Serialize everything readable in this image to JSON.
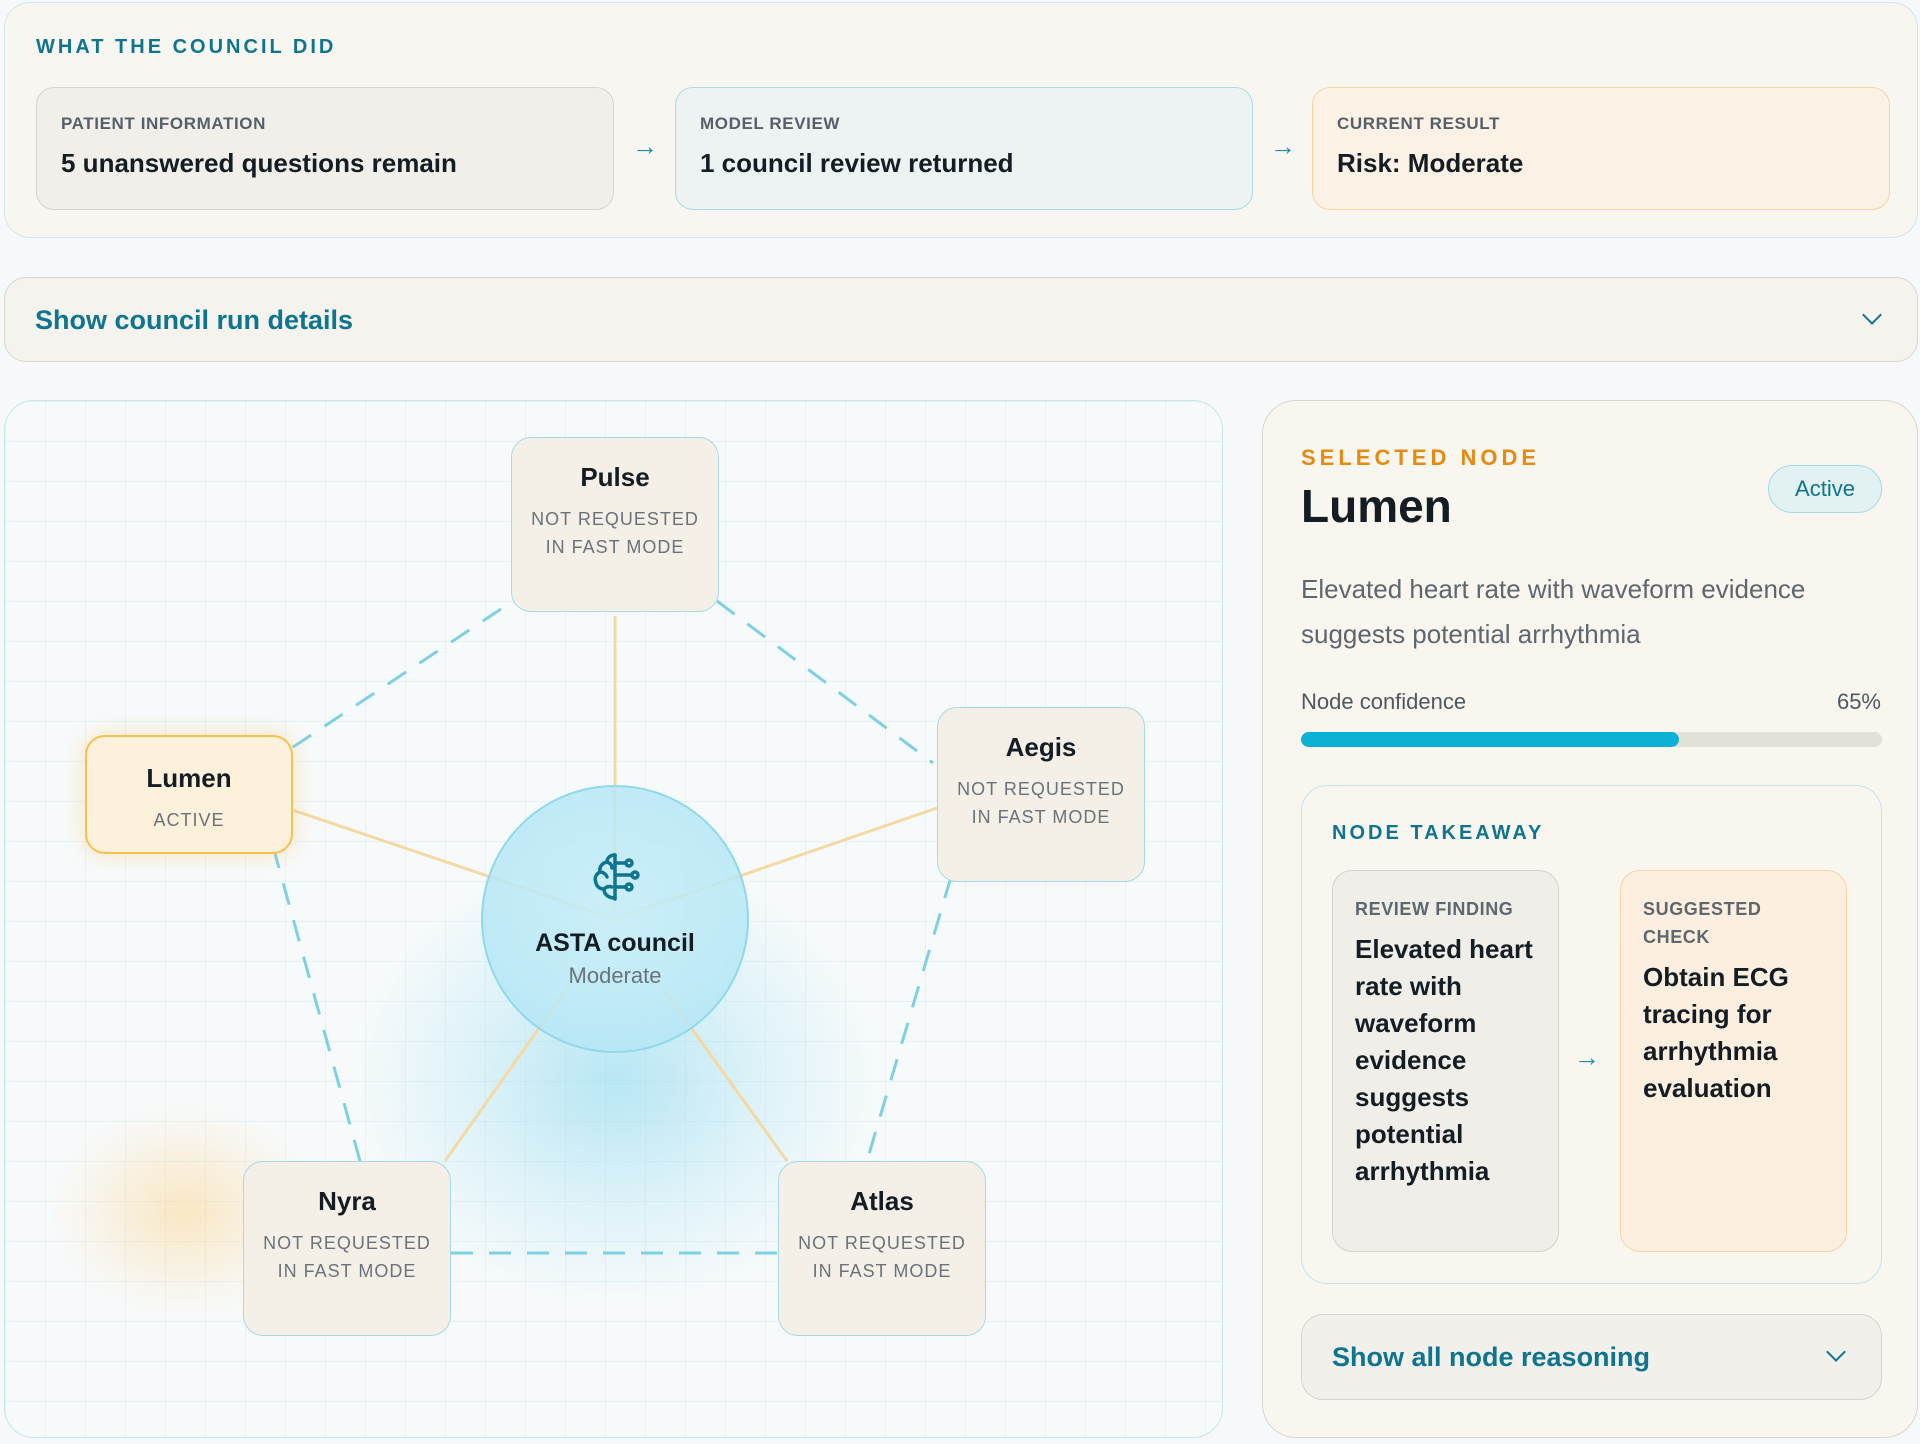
{
  "summary": {
    "heading": "WHAT THE COUNCIL DID",
    "steps": [
      {
        "label": "PATIENT INFORMATION",
        "value": "5 unanswered questions remain"
      },
      {
        "label": "MODEL REVIEW",
        "value": "1 council review returned"
      },
      {
        "label": "CURRENT RESULT",
        "value": "Risk: Moderate"
      }
    ],
    "arrow": "→"
  },
  "details_toggle": {
    "label": "Show council run details"
  },
  "graph": {
    "hub": {
      "title": "ASTA council",
      "status": "Moderate",
      "icon": "brain-icon"
    },
    "nodes": [
      {
        "name": "Pulse",
        "status": "NOT REQUESTED IN FAST MODE",
        "active": false
      },
      {
        "name": "Aegis",
        "status": "NOT REQUESTED IN FAST MODE",
        "active": false
      },
      {
        "name": "Atlas",
        "status": "NOT REQUESTED IN FAST MODE",
        "active": false
      },
      {
        "name": "Nyra",
        "status": "NOT REQUESTED IN FAST MODE",
        "active": false
      },
      {
        "name": "Lumen",
        "status": "ACTIVE",
        "active": true
      }
    ],
    "colors": {
      "ring": "#7fd0e3",
      "spoke": "#f4d9a4",
      "accent": "#0e7490",
      "active": "#f6c24f"
    }
  },
  "detail": {
    "eyebrow": "SELECTED NODE",
    "title": "Lumen",
    "badge": "Active",
    "summary": "Elevated heart rate with waveform evidence suggests potential arrhythmia",
    "confidence_label": "Node confidence",
    "confidence_value": "65%",
    "confidence_fraction": 0.65,
    "takeaway": {
      "heading": "NODE TAKEAWAY",
      "finding_label": "REVIEW FINDING",
      "finding_text": "Elevated heart rate with waveform evidence suggests potential arrhythmia",
      "check_label": "SUGGESTED CHECK",
      "check_text": "Obtain ECG tracing for arrhythmia evaluation",
      "arrow": "→"
    },
    "reasoning_toggle": {
      "label": "Show all node reasoning"
    }
  }
}
